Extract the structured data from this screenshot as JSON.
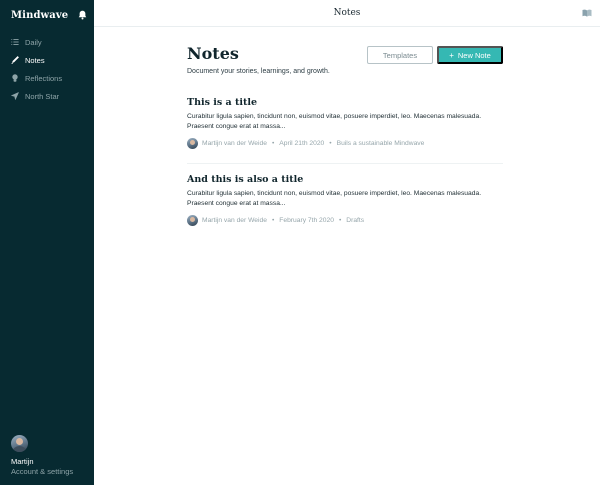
{
  "app": {
    "name": "Mindwave",
    "page_title": "Notes"
  },
  "sidebar": {
    "items": [
      {
        "label": "Daily",
        "icon": "list-icon",
        "active": false
      },
      {
        "label": "Notes",
        "icon": "pen-icon",
        "active": true
      },
      {
        "label": "Reflections",
        "icon": "lightbulb-icon",
        "active": false
      },
      {
        "label": "North Star",
        "icon": "navigation-arrow-icon",
        "active": false
      }
    ],
    "account": {
      "name": "Martijn",
      "settings_label": "Account & settings"
    }
  },
  "main": {
    "title": "Notes",
    "subtitle": "Document your stories, learnings, and growth.",
    "templates_label": "Templates",
    "new_note_label": "New Note",
    "new_note_icon": "+"
  },
  "notes": [
    {
      "title": "This is a title",
      "body": "Curabitur ligula sapien, tincidunt non, euismod vitae, posuere imperdiet, leo. Maecenas malesuada. Praesent congue erat at massa...",
      "author": "Martijn van der Weide",
      "date": "April 21th 2020",
      "tag": "Buils a sustainable Mindwave"
    },
    {
      "title": "And this is also a title",
      "body": "Curabitur ligula sapien, tincidunt non, euismod vitae, posuere imperdiet, leo. Maecenas malesuada. Praesent congue erat at massa...",
      "author": "Martijn van der Weide",
      "date": "February 7th 2020",
      "tag": "Drafts"
    }
  ],
  "colors": {
    "sidebar_bg": "#072a31",
    "accent": "#35b8b3"
  }
}
